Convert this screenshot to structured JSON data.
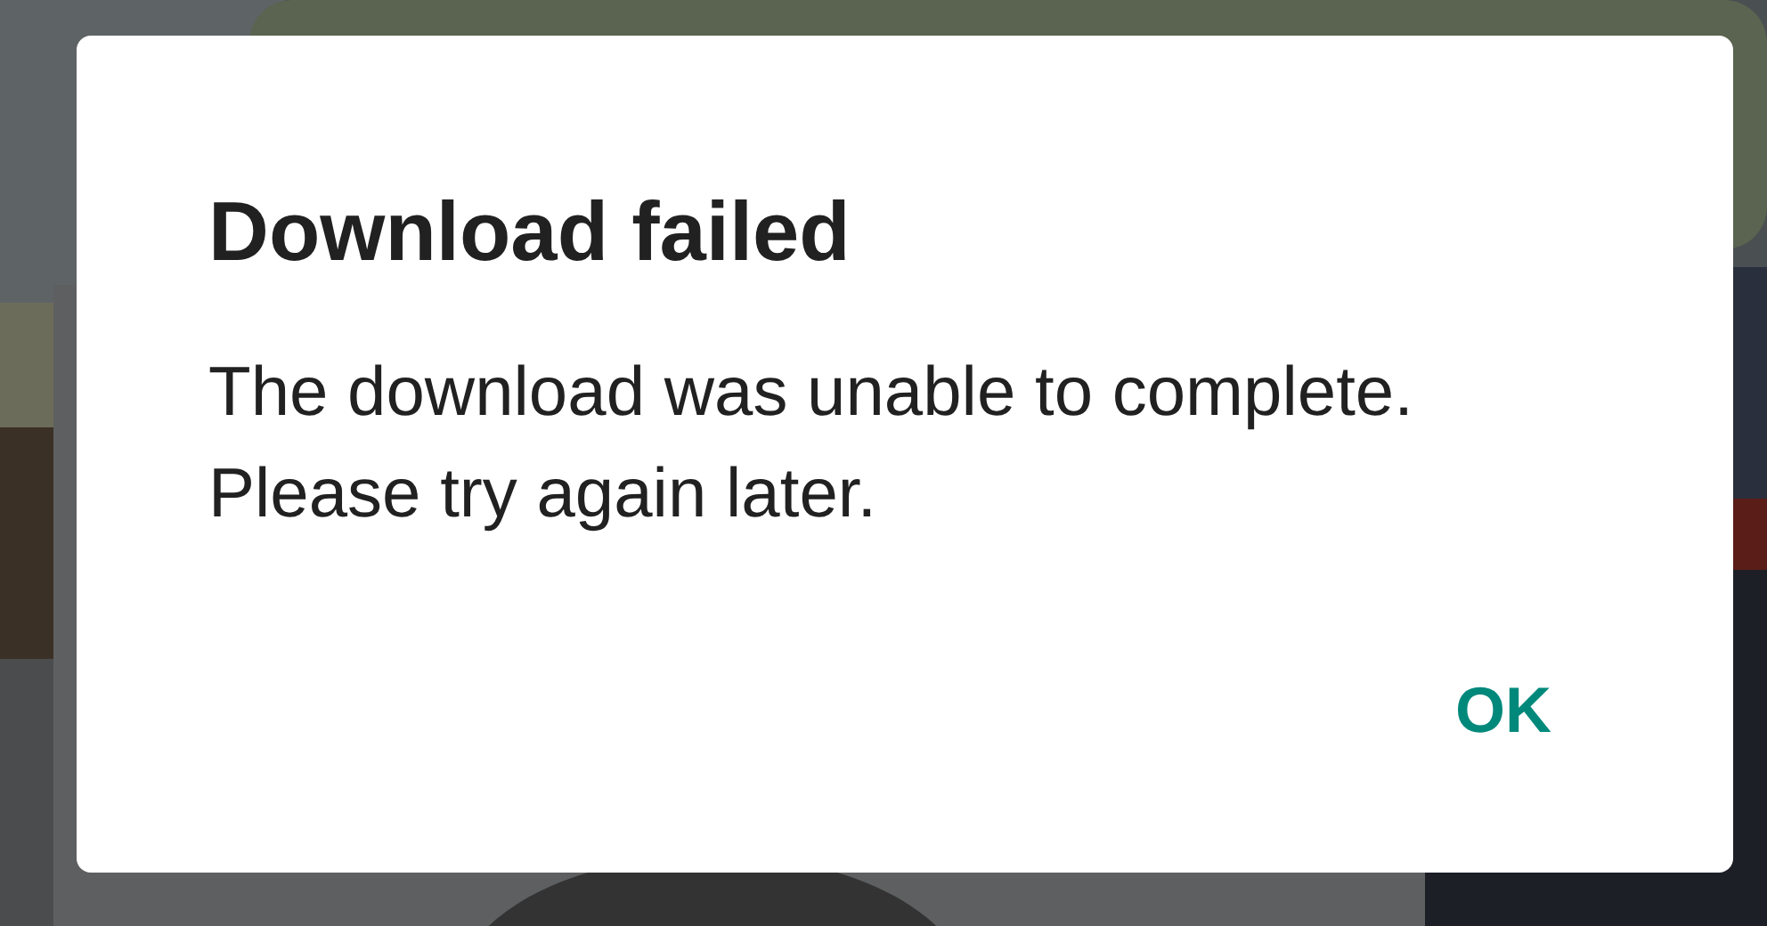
{
  "dialog": {
    "title": "Download failed",
    "message": "The download was unable to complete. Please try again later.",
    "buttons": [
      {
        "label": "OK"
      }
    ]
  }
}
